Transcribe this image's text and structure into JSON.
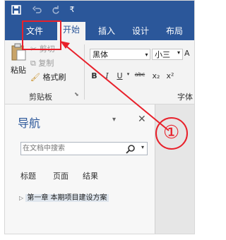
{
  "quick_access": {
    "save_icon": "save-icon",
    "undo_icon": "undo-icon",
    "redo_icon": "redo-icon",
    "customize_icon": "customize-qat-icon",
    "customize_glyph": "₹"
  },
  "ribbon_tabs": [
    "文件",
    "开始",
    "插入",
    "设计",
    "布局"
  ],
  "clipboard": {
    "paste_label": "粘贴",
    "cut_label": "剪切",
    "copy_label": "复制",
    "format_painter_label": "格式刷",
    "group_label": "剪贴板"
  },
  "font": {
    "font_name": "黑体",
    "font_size": "小三",
    "bold": "B",
    "italic": "I",
    "underline": "U",
    "strike": "abc",
    "subscript": "x₂",
    "superscript": "x²",
    "group_label": "字体"
  },
  "navigation": {
    "title": "导航",
    "search_placeholder": "在文档中搜索",
    "tabs": [
      "标题",
      "页面",
      "结果"
    ],
    "tree_item": "第一章 本期项目建设方案"
  },
  "annotation": {
    "number": "①"
  },
  "colors": {
    "ribbon_blue": "#2b579a",
    "annotation_red": "#e8202a"
  }
}
